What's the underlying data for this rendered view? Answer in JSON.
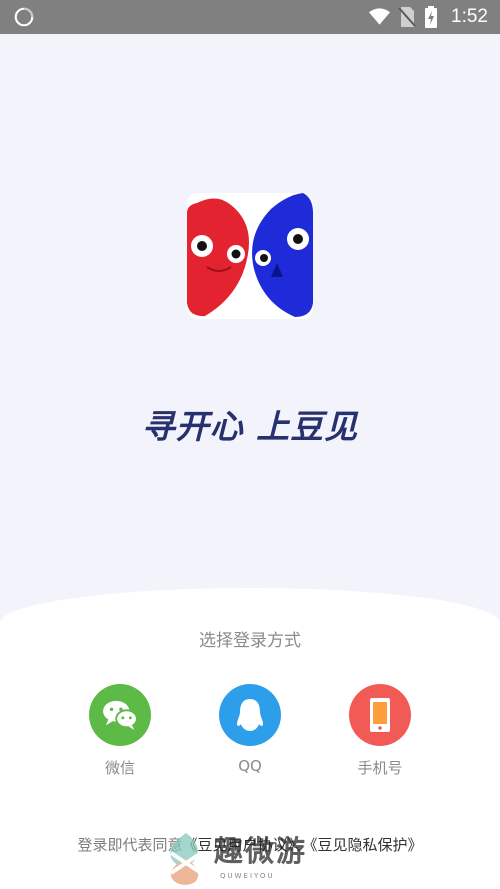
{
  "status_bar": {
    "time": "1:52",
    "icons": [
      "loading-icon",
      "wifi-icon",
      "no-sim-icon",
      "battery-charging-icon"
    ]
  },
  "hero": {
    "logo": "app-logo",
    "slogan": "寻开心 上豆见"
  },
  "login": {
    "title": "选择登录方式",
    "options": [
      {
        "label": "微信",
        "icon": "wechat-icon",
        "color": "#5dba47"
      },
      {
        "label": "QQ",
        "icon": "qq-icon",
        "color": "#2d9fea"
      },
      {
        "label": "手机号",
        "icon": "phone-icon",
        "color": "#f15a55"
      }
    ],
    "agreement_prefix": "登录即代表同意",
    "user_agreement": "《豆见用户协议》",
    "separator": "、",
    "privacy_policy": "《豆见隐私保护》"
  },
  "watermark": {
    "text": "趣微游",
    "subtext": "QUWEIYOU"
  },
  "colors": {
    "accent_red": "#e3232f",
    "accent_blue": "#1f2bd8",
    "slogan": "#27316e"
  }
}
